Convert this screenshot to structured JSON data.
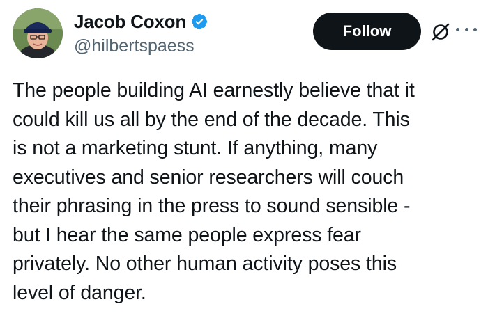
{
  "author": {
    "display_name": "Jacob Coxon",
    "handle": "@hilbertspaess",
    "verified": true,
    "avatar_icon": "profile-photo-avatar"
  },
  "actions": {
    "follow_label": "Follow",
    "grok_icon": "slashed-circle-icon",
    "more_icon": "more-horizontal-icon"
  },
  "tweet": {
    "lines": [
      "The people building AI earnestly believe that it",
      "could kill us all by the end of the decade. This",
      "is not a marketing stunt. If anything, many",
      "executives and senior researchers will couch",
      "their phrasing in the press to sound sensible -",
      "but I hear the same people express fear",
      "privately. No other human activity poses this",
      "level of danger."
    ]
  },
  "colors": {
    "text": "#0f1419",
    "secondary": "#536471",
    "verified_badge": "#1d9bf0",
    "follow_bg": "#0f1419"
  }
}
